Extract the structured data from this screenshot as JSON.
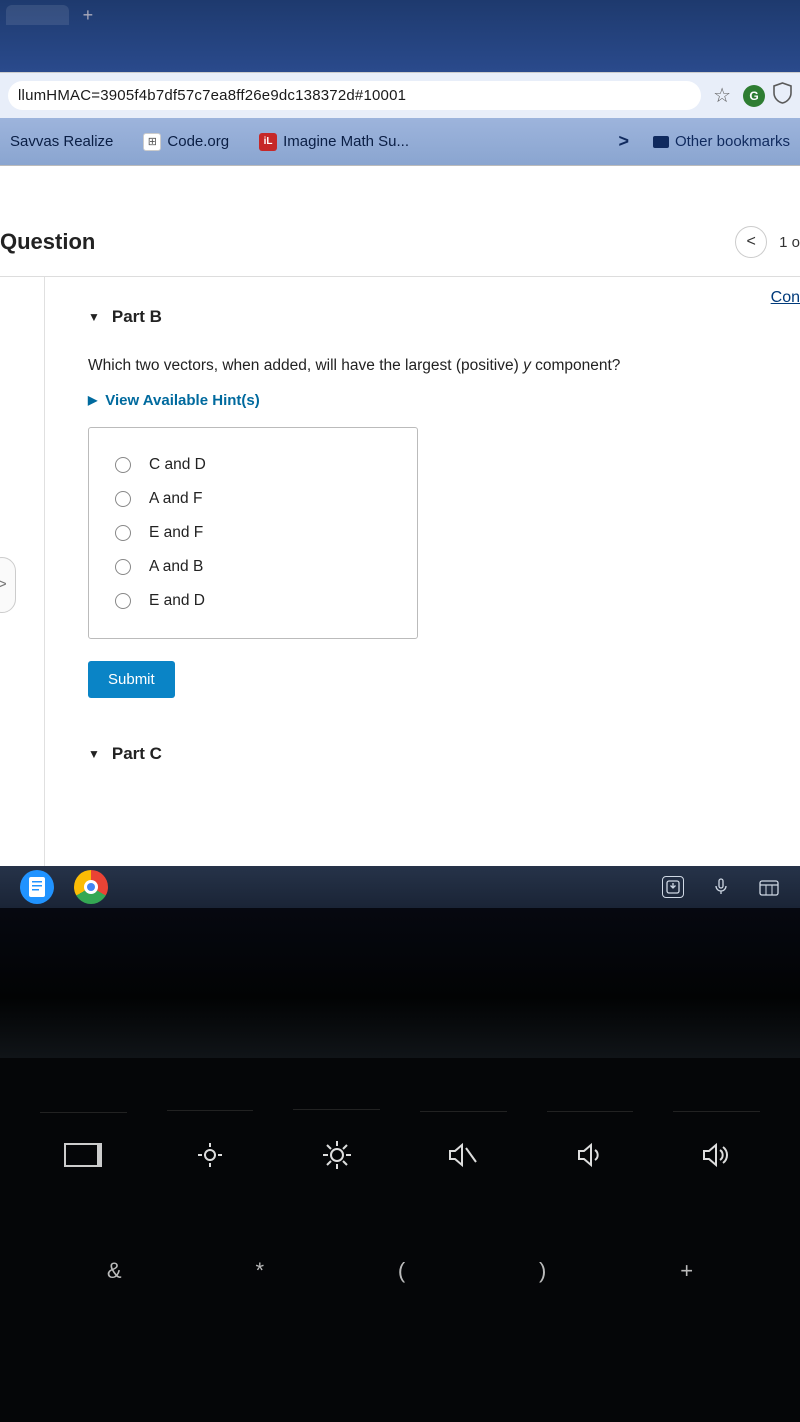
{
  "browser": {
    "url_fragment": "llumHMAC=3905f4b7df57c7ea8ff26e9dc138372d#10001",
    "bookmarks": {
      "items": [
        {
          "label": "Savvas Realize"
        },
        {
          "label": "Code.org"
        },
        {
          "label": "Imagine Math Su..."
        }
      ],
      "other": "Other bookmarks"
    }
  },
  "page": {
    "header": "Question",
    "counter": "1 o",
    "corner_link": "Con",
    "part_b": {
      "label": "Part B",
      "question_prefix": "Which two vectors, when added, will have the largest (positive) ",
      "question_italic": "y",
      "question_suffix": " component?",
      "hints": "View Available Hint(s)",
      "options": [
        "C and D",
        "A and F",
        "E and F",
        "A and B",
        "E and D"
      ],
      "submit": "Submit"
    },
    "part_c": {
      "label": "Part C"
    }
  },
  "keyboard": {
    "num_symbols": [
      "&",
      "*",
      "(",
      ")",
      "+"
    ]
  }
}
